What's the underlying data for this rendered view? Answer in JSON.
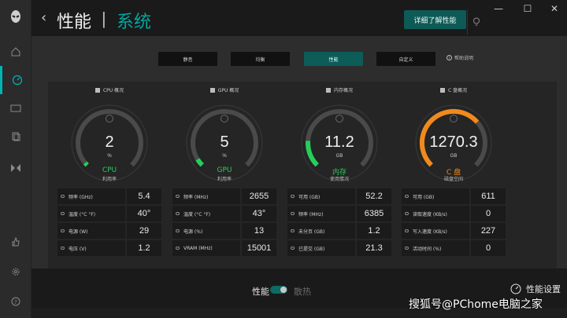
{
  "header": {
    "back": "‹",
    "title": "性能",
    "separator": "|",
    "subtitle": "系统",
    "tooltip": "详细了解性能",
    "controls": [
      "—",
      "☐",
      "✕"
    ]
  },
  "modes": {
    "buttons": [
      {
        "label": "静音",
        "active": false
      },
      {
        "label": "均衡",
        "active": false
      },
      {
        "label": "性能",
        "active": true
      },
      {
        "label": "自定义",
        "active": false
      }
    ],
    "help": "帮助说明"
  },
  "columns": [
    {
      "title": "CPU 概况",
      "gauge": {
        "value": "2",
        "unit": "%",
        "label": "CPU",
        "sub": "利用率",
        "color": "#24d05a",
        "fraction": 0.02
      },
      "stats": [
        {
          "label": "频率 (GHz)",
          "value": "5.4"
        },
        {
          "label": "温度 (°C  °F)",
          "value": "40°"
        },
        {
          "label": "电源 (W)",
          "value": "29"
        },
        {
          "label": "电压 (V)",
          "value": "1.2"
        }
      ]
    },
    {
      "title": "GPU 概况",
      "gauge": {
        "value": "5",
        "unit": "%",
        "label": "GPU",
        "sub": "利用率",
        "color": "#24d05a",
        "fraction": 0.05
      },
      "stats": [
        {
          "label": "频率 (MHz)",
          "value": "2655"
        },
        {
          "label": "温度 (°C  °F)",
          "value": "43°"
        },
        {
          "label": "电源 (%)",
          "value": "13"
        },
        {
          "label": "VRAM (MHz)",
          "value": "15001"
        }
      ]
    },
    {
      "title": "内存概况",
      "gauge": {
        "value": "11.2",
        "unit": "GB",
        "label": "内存",
        "sub": "使用情况",
        "color": "#24d05a",
        "fraction": 0.18
      },
      "stats": [
        {
          "label": "可用 (GB)",
          "value": "52.2"
        },
        {
          "label": "频率 (MHz)",
          "value": "6385"
        },
        {
          "label": "未分页 (GB)",
          "value": "1.2"
        },
        {
          "label": "已提交 (GB)",
          "value": "21.3"
        }
      ]
    },
    {
      "title": "C 盘概况",
      "gauge": {
        "value": "1270.3",
        "unit": "GB",
        "label": "C 盘",
        "sub": "磁盘空间",
        "color": "#f08a1c",
        "fraction": 0.68
      },
      "stats": [
        {
          "label": "可用 (GB)",
          "value": "611"
        },
        {
          "label": "读取速度 (KB/s)",
          "value": "0"
        },
        {
          "label": "写入速度 (KB/s)",
          "value": "227"
        },
        {
          "label": "活动时间 (%)",
          "value": "0"
        }
      ]
    }
  ],
  "bottom": {
    "performance": "性能",
    "quiet": "散热",
    "settings": "性能设置"
  },
  "watermark": "搜狐号@PChome电脑之家",
  "colors": {
    "accent": "#00a8a0",
    "green": "#24d05a",
    "orange": "#f08a1c"
  }
}
